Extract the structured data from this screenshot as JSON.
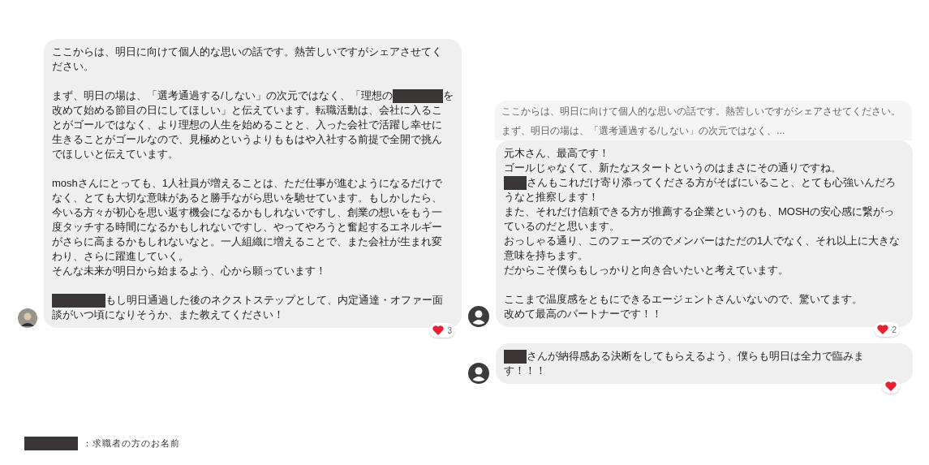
{
  "left_messages": [
    {
      "avatar": {
        "kind": "photo"
      },
      "paragraphs": [
        [
          [
            {
              "kind": "text",
              "text": "ここからは、明日に向けて個人的な思いの話です。熱苦しいですがシェアさせてく"
            }
          ],
          [
            {
              "kind": "text",
              "text": "ださい。"
            }
          ]
        ],
        [
          [
            {
              "kind": "text",
              "text": "まず、明日の場は、「選考通過する/しない」の次元ではなく、「理想の"
            },
            {
              "kind": "redaction"
            },
            {
              "kind": "text",
              "text": "を"
            }
          ],
          [
            {
              "kind": "text",
              "text": "改めて始める節目の日にしてほしい」と伝えています。転職活動は、会社に入るこ"
            }
          ],
          [
            {
              "kind": "text",
              "text": "とがゴールではなく、より理想の人生を始めることと、入った会社で活躍し幸せに"
            }
          ],
          [
            {
              "kind": "text",
              "text": "生きることがゴールなので、見極めというよりももはや入社する前提で全開で挑ん"
            }
          ],
          [
            {
              "kind": "text",
              "text": "でほしいと伝えています。"
            }
          ]
        ],
        [
          [
            {
              "kind": "text",
              "text": "moshさんにとっても、1人社員が増えることは、ただ仕事が進むようになるだけで"
            }
          ],
          [
            {
              "kind": "text",
              "text": "なく、とても大切な意味があると勝手ながら思いを馳せています。もしかしたら、"
            }
          ],
          [
            {
              "kind": "text",
              "text": "今いる方々が初心を思い返す機会になるかもしれないですし、創業の想いをもう一"
            }
          ],
          [
            {
              "kind": "text",
              "text": "度タッチする時間になるかもしれないですし、やってやろうと奮起するエネルギー"
            }
          ],
          [
            {
              "kind": "text",
              "text": "がさらに高まるかもしれないなと。一人組織に増えることで、また会社が生まれ変"
            }
          ],
          [
            {
              "kind": "text",
              "text": "わり、さらに躍進していく。"
            }
          ],
          [
            {
              "kind": "text",
              "text": "そんな未来が明日から始まるよう、心から願っています！"
            }
          ]
        ],
        [
          [
            {
              "kind": "redaction"
            },
            {
              "kind": "text",
              "text": "もし明日通過した後のネクストステップとして、内定通達・オファー面"
            }
          ],
          [
            {
              "kind": "text",
              "text": "談がいつ頃になりそうか、また教えてください！"
            }
          ]
        ]
      ],
      "reaction": {
        "kind": "heart",
        "count": "3"
      }
    }
  ],
  "right_messages": [
    {
      "avatar": {
        "kind": "default"
      },
      "quote": {
        "lines": [
          "ここからは、明日に向けて個人的な思いの話です。熱苦しいですがシェアさせてください。",
          "まず、明日の場は、「選考通過する/しない」の次元ではなく、..."
        ]
      },
      "paragraphs": [
        [
          [
            {
              "kind": "text",
              "text": "元木さん、最高です！"
            }
          ],
          [
            {
              "kind": "text",
              "text": "ゴールじゃなくて、新たなスタートというのはまさにその通りですね。"
            }
          ],
          [
            {
              "kind": "initials"
            },
            {
              "kind": "text",
              "text": "さんもこれだけ寄り添ってくださる方がそばにいること、とても心強いんだろ"
            }
          ],
          [
            {
              "kind": "text",
              "text": "うなと推察します！"
            }
          ],
          [
            {
              "kind": "text",
              "text": "また、それだけ信頼できる方が推薦する企業というのも、MOSHの安心感に繋がっ"
            }
          ],
          [
            {
              "kind": "text",
              "text": "ているのだと思います。"
            }
          ],
          [
            {
              "kind": "text",
              "text": "おっしゃる通り、このフェーズのでメンバーはただの1人でなく、それ以上に大きな"
            }
          ],
          [
            {
              "kind": "text",
              "text": "意味を持ちます。"
            }
          ],
          [
            {
              "kind": "text",
              "text": "だからこそ僕らもしっかりと向き合いたいと考えています。"
            }
          ]
        ],
        [
          [
            {
              "kind": "text",
              "text": "ここまで温度感をともにできるエージェントさんいないので、驚いてます。"
            }
          ],
          [
            {
              "kind": "text",
              "text": "改めて最高のパートナーです！！"
            }
          ]
        ]
      ],
      "reaction": {
        "kind": "heart",
        "count": "2"
      }
    },
    {
      "avatar": {
        "kind": "default"
      },
      "paragraphs": [
        [
          [
            {
              "kind": "initials"
            },
            {
              "kind": "text",
              "text": "さんが納得感ある決断をしてもらえるよう、僕らも明日は全力で臨みま"
            }
          ],
          [
            {
              "kind": "text",
              "text": "す！！！"
            }
          ]
        ]
      ],
      "reaction": {
        "kind": "heart"
      }
    }
  ],
  "legend": {
    "mark": {
      "kind": "redaction"
    },
    "text": "：求職者の方のお名前"
  }
}
